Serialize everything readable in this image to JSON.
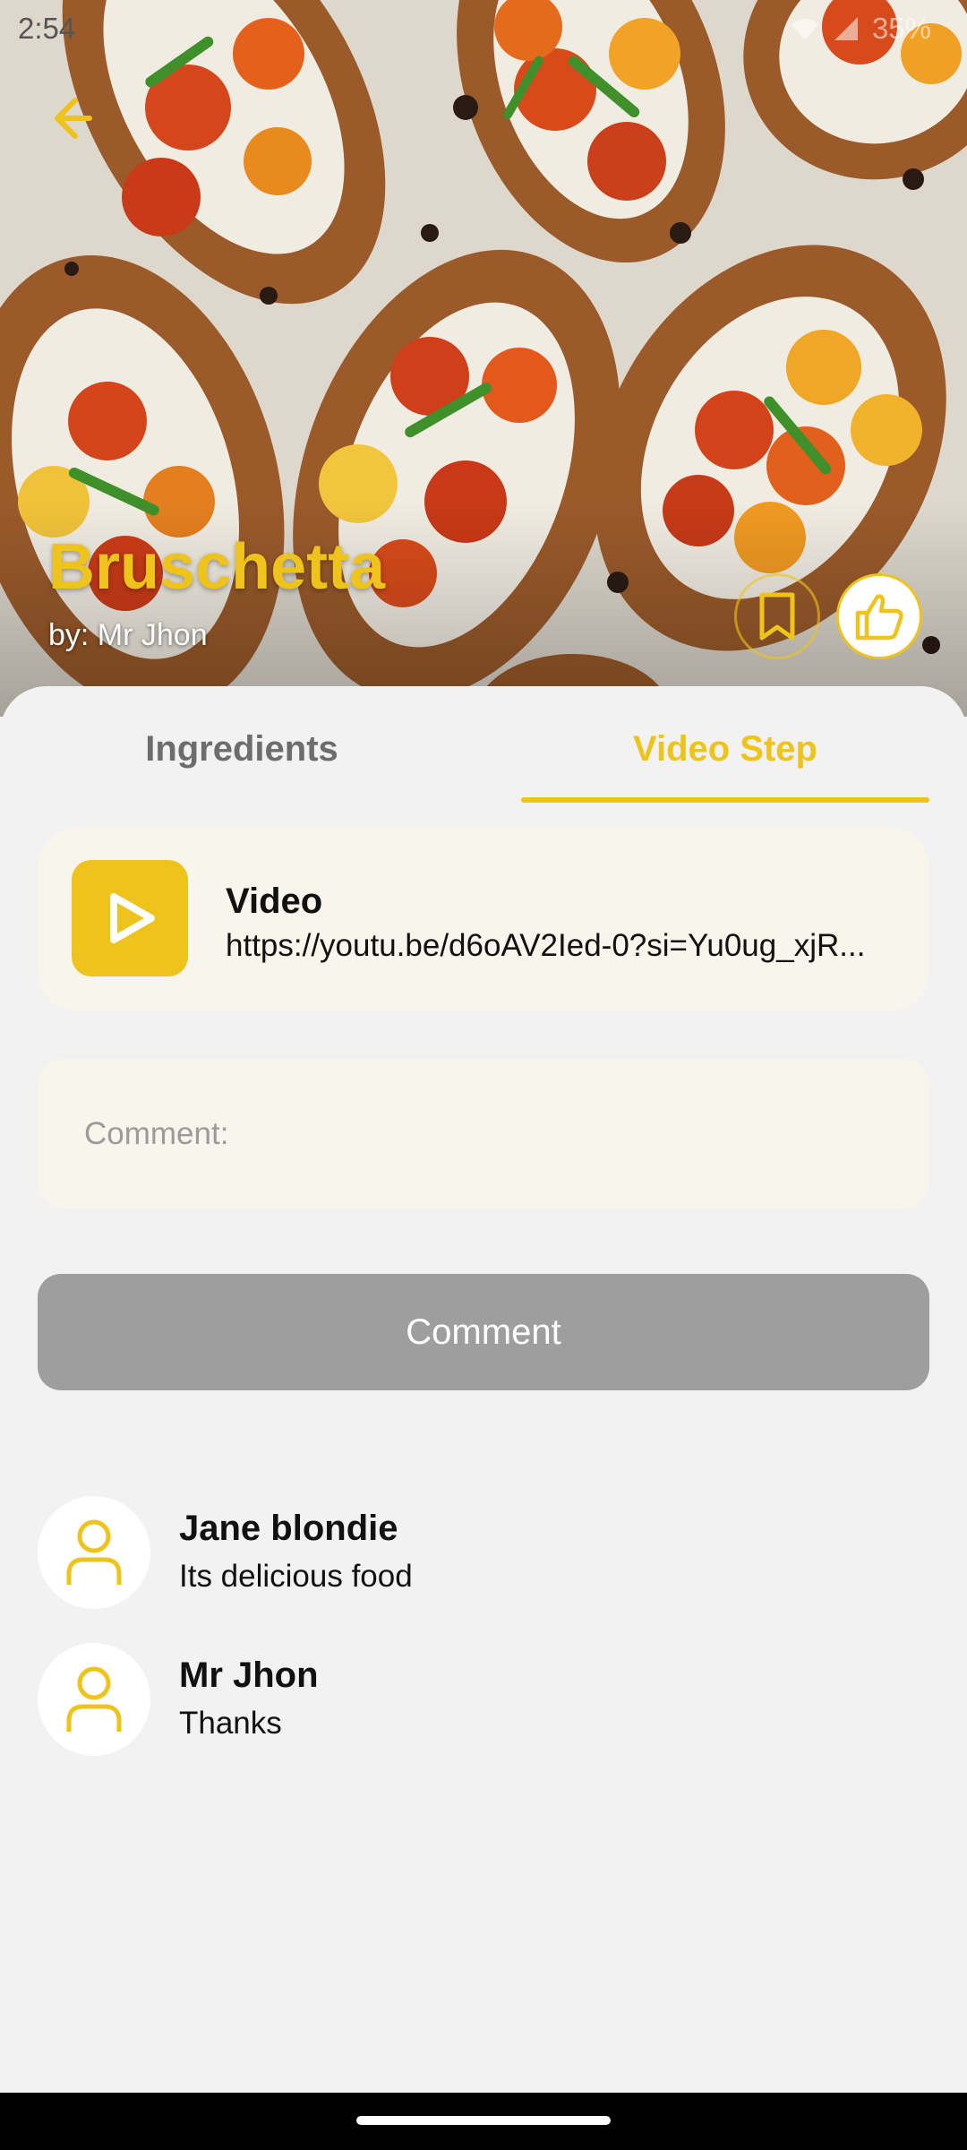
{
  "status_bar": {
    "time": "2:54",
    "battery": "35%"
  },
  "recipe": {
    "title": "Bruschetta",
    "author": "by: Mr Jhon"
  },
  "tabs": [
    {
      "label": "Ingredients",
      "active": false
    },
    {
      "label": "Video Step",
      "active": true
    }
  ],
  "video": {
    "title": "Video",
    "url": "https://youtu.be/d6oAV2Ied-0?si=Yu0ug_xjR..."
  },
  "comment_input": {
    "placeholder": "Comment:",
    "value": ""
  },
  "comment_button": {
    "label": "Comment"
  },
  "comments": [
    {
      "name": "Jane blondie",
      "text": "Its delicious food"
    },
    {
      "name": "Mr Jhon",
      "text": "Thanks"
    }
  ],
  "colors": {
    "accent": "#eec31c",
    "background": "#f2f2f2",
    "card": "#f7f5ec",
    "button_disabled": "#9e9e9e"
  },
  "icons": [
    "back-arrow-icon",
    "bookmark-icon",
    "thumbs-up-icon",
    "play-icon",
    "person-icon"
  ]
}
